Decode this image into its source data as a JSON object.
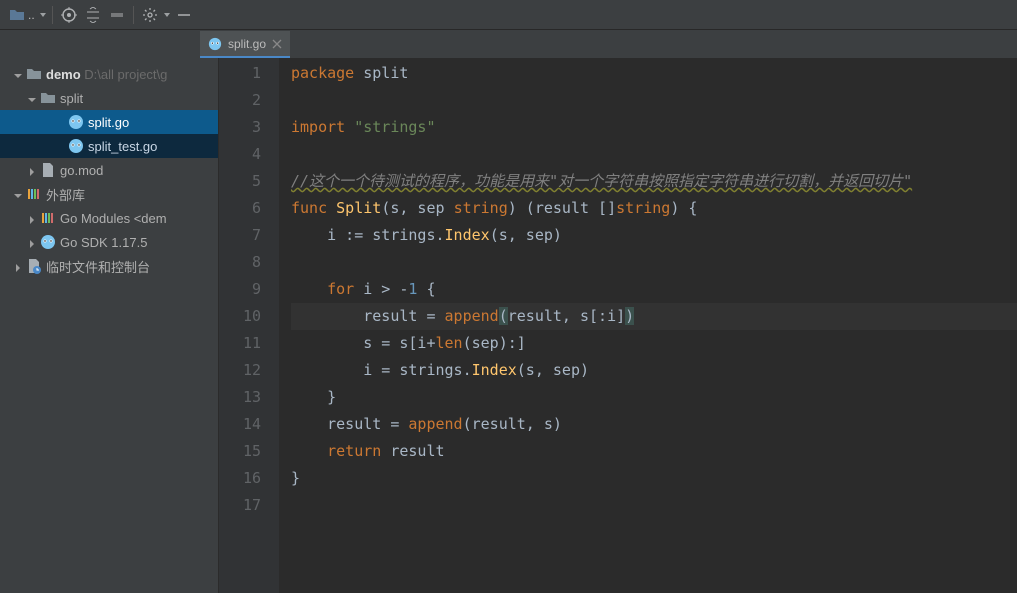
{
  "toolbar": {
    "project_btn": ".."
  },
  "tabs": {
    "active": "split.go"
  },
  "tree": {
    "root_name": "demo",
    "root_path": "D:\\all project\\g",
    "split_dir": "split",
    "file_split": "split.go",
    "file_split_test": "split_test.go",
    "go_mod": "go.mod",
    "ext_lib": "外部库",
    "go_modules": "Go Modules <dem",
    "go_sdk": "Go SDK 1.17.5",
    "scratch": "临时文件和控制台"
  },
  "code": {
    "l1": "package",
    "l1b": " split",
    "l3a": "import ",
    "l3b": "\"strings\"",
    "l5": "//这个一个待测试的程序，功能是用来\"对一个字符串按照指定字符串进行切割，并返回切片\"",
    "l6a": "func ",
    "l6b": "Split",
    "l6c": "(s, sep ",
    "l6d": "string",
    "l6e": ") (result []",
    "l6f": "string",
    "l6g": ") {",
    "l7a": "    i := strings.",
    "l7b": "Index",
    "l7c": "(s, sep)",
    "l9a": "    for ",
    "l9b": "i > -",
    "l9n": "1",
    "l9c": " {",
    "l10a": "        result = ",
    "l10b": "append",
    "l10c": "(",
    "l10d": "result, s[:i]",
    "l10e": ")",
    "l11a": "        s = s[i+",
    "l11b": "len",
    "l11c": "(sep):]",
    "l12a": "        i = strings.",
    "l12b": "Index",
    "l12c": "(s, sep)",
    "l13": "    }",
    "l14a": "    result = ",
    "l14b": "append",
    "l14c": "(result, s)",
    "l15a": "    return ",
    "l15b": "result",
    "l16": "}",
    "lines": [
      "1",
      "2",
      "3",
      "4",
      "5",
      "6",
      "7",
      "8",
      "9",
      "10",
      "11",
      "12",
      "13",
      "14",
      "15",
      "16",
      "17"
    ]
  }
}
